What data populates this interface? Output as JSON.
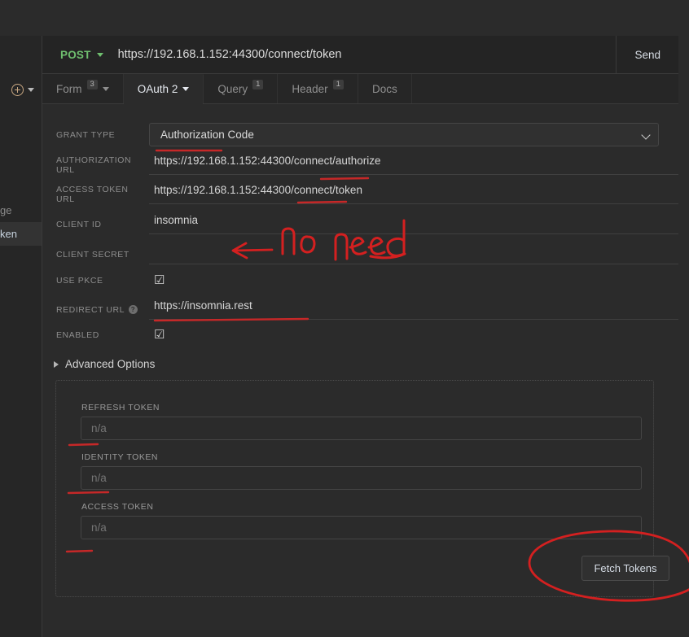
{
  "request_bar": {
    "method": "POST",
    "method_caret_icon": "chevron-down-icon",
    "url": "https://192.168.1.152:44300/connect/token",
    "send_label": "Send"
  },
  "tabs": [
    {
      "label": "Form",
      "badge": "3",
      "caret": true,
      "active": false
    },
    {
      "label": "OAuth 2",
      "badge": "",
      "caret": true,
      "active": true
    },
    {
      "label": "Query",
      "badge": "1",
      "caret": false,
      "active": false
    },
    {
      "label": "Header",
      "badge": "1",
      "caret": false,
      "active": false
    },
    {
      "label": "Docs",
      "badge": "",
      "caret": false,
      "active": false
    }
  ],
  "sidebar": {
    "add_icon": "plus-circle-icon",
    "add_caret_icon": "chevron-down-icon",
    "items": [
      {
        "label": "ge",
        "active": false
      },
      {
        "label": "ken",
        "active": true
      }
    ]
  },
  "oauth_form": {
    "grant_type": {
      "label": "GRANT TYPE",
      "value": "Authorization Code",
      "caret_icon": "chevron-down-icon"
    },
    "authorization_url": {
      "label": "AUTHORIZATION URL",
      "value": "https://192.168.1.152:44300/connect/authorize"
    },
    "access_token_url": {
      "label": "ACCESS TOKEN URL",
      "value": "https://192.168.1.152:44300/connect/token"
    },
    "client_id": {
      "label": "CLIENT ID",
      "value": "insomnia"
    },
    "client_secret": {
      "label": "CLIENT SECRET",
      "value": ""
    },
    "use_pkce": {
      "label": "USE PKCE",
      "checkbox_icon": "checkbox-checked-icon",
      "checked_glyph": "☑"
    },
    "redirect_url": {
      "label": "REDIRECT URL",
      "help_icon": "question-mark-icon",
      "help_glyph": "?",
      "value": "https://insomnia.rest"
    },
    "enabled": {
      "label": "ENABLED",
      "checkbox_icon": "checkbox-checked-icon",
      "checked_glyph": "☑"
    }
  },
  "advanced": {
    "toggle_label": "Advanced Options",
    "toggle_icon": "triangle-right-icon",
    "refresh_token": {
      "label": "REFRESH TOKEN",
      "placeholder": "n/a",
      "value": ""
    },
    "identity_token": {
      "label": "IDENTITY TOKEN",
      "placeholder": "n/a",
      "value": ""
    },
    "access_token": {
      "label": "ACCESS TOKEN",
      "placeholder": "n/a",
      "value": ""
    },
    "fetch_button": "Fetch Tokens"
  },
  "annotations": {
    "note_text": "no need",
    "arrow_icon": "left-arrow-annotation",
    "circle_icon": "ellipse-annotation",
    "color": "#d42020",
    "underline_color": "#c62828"
  },
  "colors": {
    "background": "#2b2b2b",
    "panel": "#2b2b2b",
    "topbar": "#242424",
    "tabbar": "#262626",
    "method_green": "#6fbf6f",
    "accent_plus": "#c9a882",
    "text_primary": "#dcdcdc",
    "text_muted": "#8d8d8d"
  }
}
